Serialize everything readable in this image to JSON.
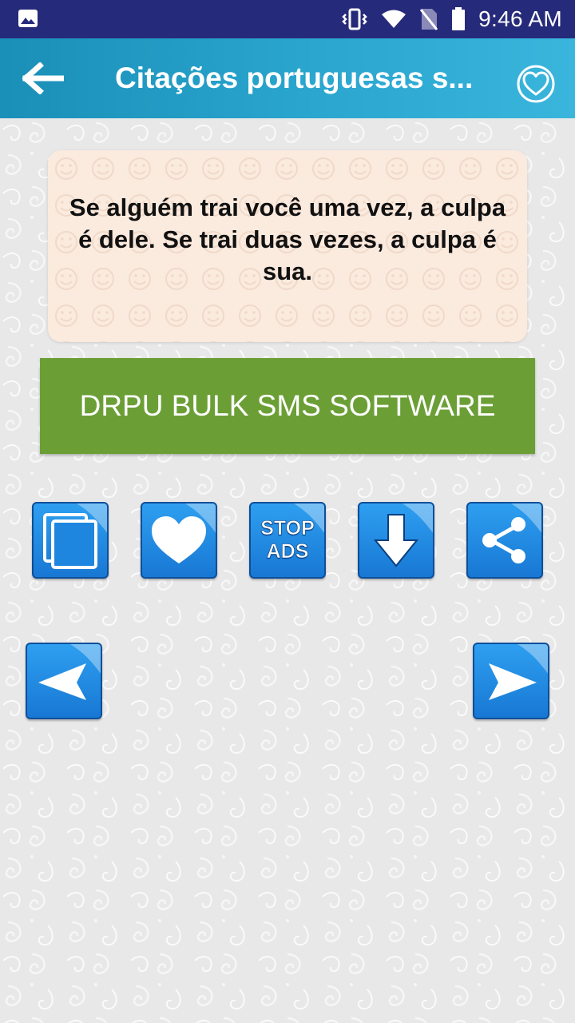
{
  "status_bar": {
    "time": "9:46 AM"
  },
  "header": {
    "title": "Citações portuguesas s...",
    "back_icon": "arrow-left-icon",
    "favorites_icon": "heart-outline-circle-icon"
  },
  "quote": {
    "text": "Se alguém trai você uma vez, a culpa é dele. Se trai duas vezes, a culpa é sua."
  },
  "promo": {
    "label": "DRPU BULK SMS SOFTWARE"
  },
  "actions": {
    "copy_icon": "copy-icon",
    "favorite_icon": "heart-icon",
    "stop_ads_line1": "STOP",
    "stop_ads_line2": "ADS",
    "save_icon": "download-arrow-icon",
    "share_icon": "share-icon"
  },
  "navigation": {
    "prev_icon": "previous-arrow-icon",
    "next_icon": "next-arrow-icon"
  },
  "colors": {
    "status_bar": "#262a7a",
    "app_bar_start": "#1a8fb7",
    "app_bar_end": "#3ab5dc",
    "quote_card": "#fbeade",
    "promo_button": "#6b9f36",
    "tile_blue": "#1f86e0"
  }
}
